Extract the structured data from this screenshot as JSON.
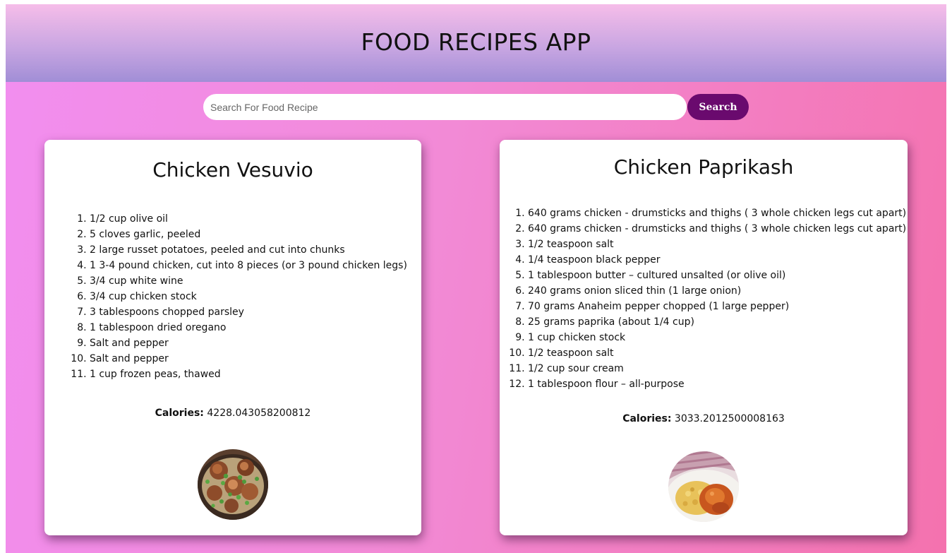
{
  "header": {
    "title": "FOOD RECIPES APP"
  },
  "search": {
    "placeholder": "Search For Food Recipe",
    "value": "",
    "button_label": "Search"
  },
  "recipes": [
    {
      "title": "Chicken Vesuvio",
      "ingredients": [
        "1/2 cup olive oil",
        "5 cloves garlic, peeled",
        "2 large russet potatoes, peeled and cut into chunks",
        "1 3-4 pound chicken, cut into 8 pieces (or 3 pound chicken legs)",
        "3/4 cup white wine",
        "3/4 cup chicken stock",
        "3 tablespoons chopped parsley",
        "1 tablespoon dried oregano",
        "Salt and pepper",
        "Salt and pepper",
        "1 cup frozen peas, thawed"
      ],
      "calories_label": "Calories:",
      "calories_value": "4228.043058200812",
      "image_icon": "chicken-vesuvio-photo"
    },
    {
      "title": "Chicken Paprikash",
      "ingredients": [
        "640 grams chicken - drumsticks and thighs ( 3 whole chicken legs cut apart)",
        "640 grams chicken - drumsticks and thighs ( 3 whole chicken legs cut apart)",
        "1/2 teaspoon salt",
        "1/4 teaspoon black pepper",
        "1 tablespoon butter – cultured unsalted (or olive oil)",
        "240 grams onion sliced thin (1 large onion)",
        "70 grams Anaheim pepper chopped (1 large pepper)",
        "25 grams paprika (about 1/4 cup)",
        "1 cup chicken stock",
        "1/2 teaspoon salt",
        "1/2 cup sour cream",
        "1 tablespoon flour – all-purpose"
      ],
      "calories_label": "Calories:",
      "calories_value": "3033.2012500008163",
      "image_icon": "chicken-paprikash-photo"
    }
  ],
  "colors": {
    "search_button": "#6a0a6e",
    "background_left": "#f28ef0",
    "background_right": "#f472ae",
    "header_top": "#f6bde9",
    "header_bottom": "#a18ed6"
  }
}
